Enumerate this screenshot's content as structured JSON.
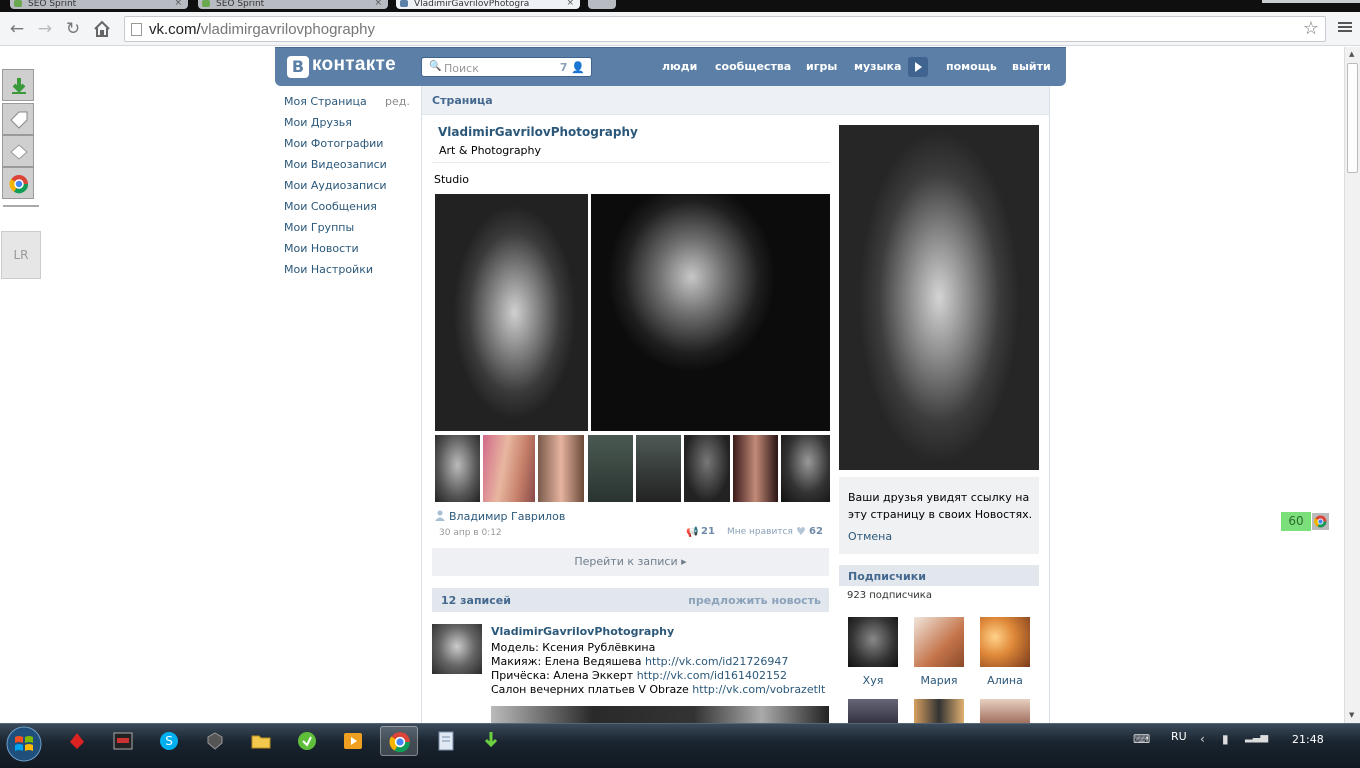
{
  "browser": {
    "tabs": [
      {
        "label": "SEO Sprint",
        "active": false
      },
      {
        "label": "SEO Sprint",
        "active": false
      },
      {
        "label": "VladimirGavrilovPhotogra",
        "active": true
      }
    ],
    "url_domain": "vk.com/",
    "url_path": "vladimirgavrilovphography"
  },
  "vk_header": {
    "logo_letter": "В",
    "logo_text": "контакте",
    "search_placeholder": "Поиск",
    "search_count": "7",
    "nav": [
      "люди",
      "сообщества",
      "игры",
      "музыка",
      "помощь",
      "выйти"
    ]
  },
  "leftnav": {
    "items": [
      "Моя Страница",
      "Мои Друзья",
      "Мои Фотографии",
      "Мои Видеозаписи",
      "Мои Аудиозаписи",
      "Мои Сообщения",
      "Мои Группы",
      "Мои Новости",
      "Мои Настройки"
    ],
    "edit": "ред."
  },
  "page": {
    "section_title": "Страница",
    "name": "VladimirGavrilovPhotography",
    "status": "Art & Photography",
    "post_text": "Studio",
    "author": "Владимир Гаврилов",
    "date": "30 апр в 0:12",
    "reposts": "21",
    "like_label": "Мне нравится",
    "likes": "62",
    "goto_post": "Перейти к записи",
    "posts_count": "12 записей",
    "suggest": "предложить новость"
  },
  "wall": {
    "author": "VladimirGavrilovPhotography",
    "lines": [
      {
        "text": "Модель: Ксения Рублёвкина",
        "link": ""
      },
      {
        "text": "Макияж: Елена Ведяшева ",
        "link": "http://vk.com/id21726947"
      },
      {
        "text": "Причёска: Алена Эккерт ",
        "link": "http://vk.com/id161402152"
      },
      {
        "text": "Салон вечерних платьев V Obraze ",
        "link": "http://vk.com/vobrazetlt"
      }
    ]
  },
  "sidebar": {
    "notice": "Ваши друзья увидят ссылку на эту страницу в своих Новостях.",
    "cancel": "Отмена",
    "subs_title": "Подписчики",
    "subs_count": "923 подписчика",
    "subscribers": [
      "Хуя",
      "Мария",
      "Алина"
    ]
  },
  "overlay": {
    "lr_label": "LR",
    "badge_value": "60"
  },
  "taskbar": {
    "lang": "RU",
    "time": "21:48"
  }
}
